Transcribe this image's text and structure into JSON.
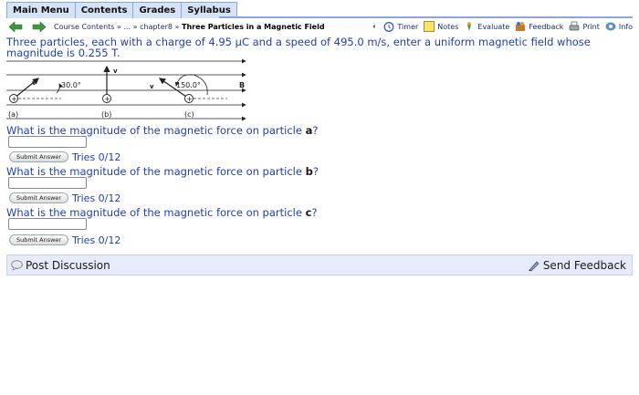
{
  "menu": {
    "items": [
      "Main Menu",
      "Contents",
      "Grades",
      "Syllabus"
    ]
  },
  "breadcrumb": {
    "course_contents": "Course Contents",
    "sep1": "»",
    "ellipsis": "...",
    "sep2": "»",
    "chapter": "chapter8",
    "sep3": "»",
    "current": "Three Particles in a Magnetic Field"
  },
  "tools": {
    "timer": "Timer",
    "notes": "Notes",
    "evaluate": "Evaluate",
    "feedback": "Feedback",
    "print": "Print",
    "info": "Info"
  },
  "problem": {
    "text": "Three particles, each with a charge of 4.95 μC and a speed of 495.0 m/s, enter a uniform magnetic field whose magnitude is 0.255 T."
  },
  "figure": {
    "angle_a": "30.0°",
    "angle_c": "150.0°",
    "v_label": "v",
    "b_label": "B",
    "label_a": "(a)",
    "label_b": "(b)",
    "label_c": "(c)",
    "plus": "+"
  },
  "questions": [
    {
      "prefix": "What is the magnitude of the magnetic force on particle ",
      "particle": "a",
      "suffix": "?",
      "submit": "Submit Answer",
      "tries": "Tries 0/12"
    },
    {
      "prefix": "What is the magnitude of the magnetic force on particle ",
      "particle": "b",
      "suffix": "?",
      "submit": "Submit Answer",
      "tries": "Tries 0/12"
    },
    {
      "prefix": "What is the magnitude of the magnetic force on particle ",
      "particle": "c",
      "suffix": "?",
      "submit": "Submit Answer",
      "tries": "Tries 0/12"
    }
  ],
  "footer": {
    "post_discussion": "Post Discussion",
    "send_feedback": "Send Feedback"
  },
  "colors": {
    "menu_bg": "#d6e3f6",
    "link_blue": "#1f3fb5",
    "bar_bg": "#e5ebf9",
    "arrow_green": "#3a9a3a"
  }
}
